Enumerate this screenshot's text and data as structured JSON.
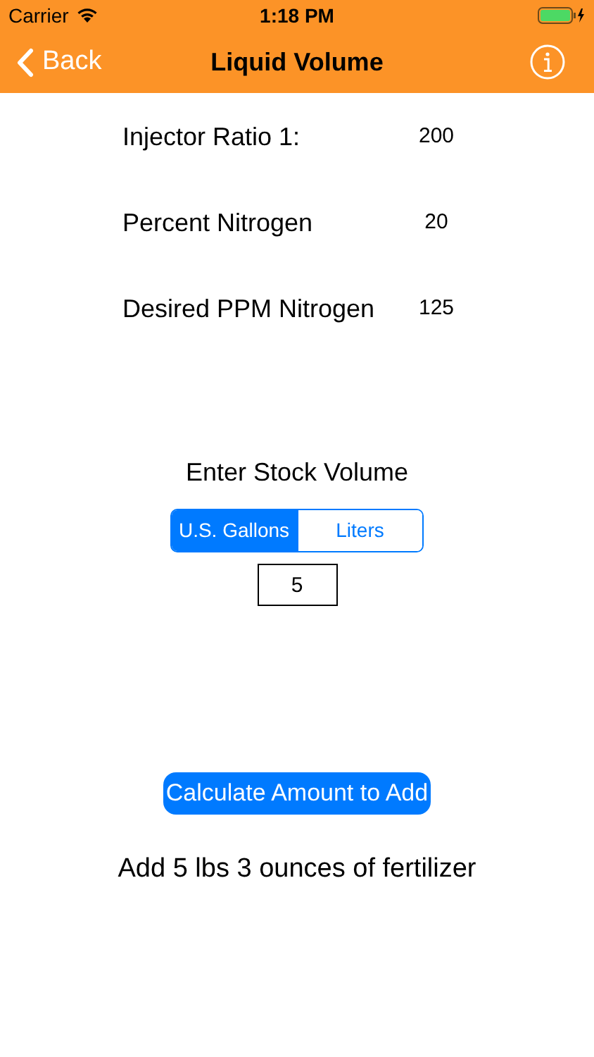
{
  "status_bar": {
    "carrier": "Carrier",
    "time": "1:18 PM"
  },
  "nav": {
    "back": "Back",
    "title": "Liquid Volume"
  },
  "fields": [
    {
      "label": "Injector Ratio 1:",
      "value": "200"
    },
    {
      "label": "Percent Nitrogen",
      "value": "20"
    },
    {
      "label": "Desired PPM Nitrogen",
      "value": "125"
    }
  ],
  "stock": {
    "heading": "Enter Stock Volume",
    "units": [
      {
        "label": "U.S. Gallons",
        "selected": true
      },
      {
        "label": "Liters",
        "selected": false
      }
    ],
    "value": "5"
  },
  "action": "Calculate Amount to Add",
  "result": "Add 5 lbs 3 ounces of fertilizer"
}
